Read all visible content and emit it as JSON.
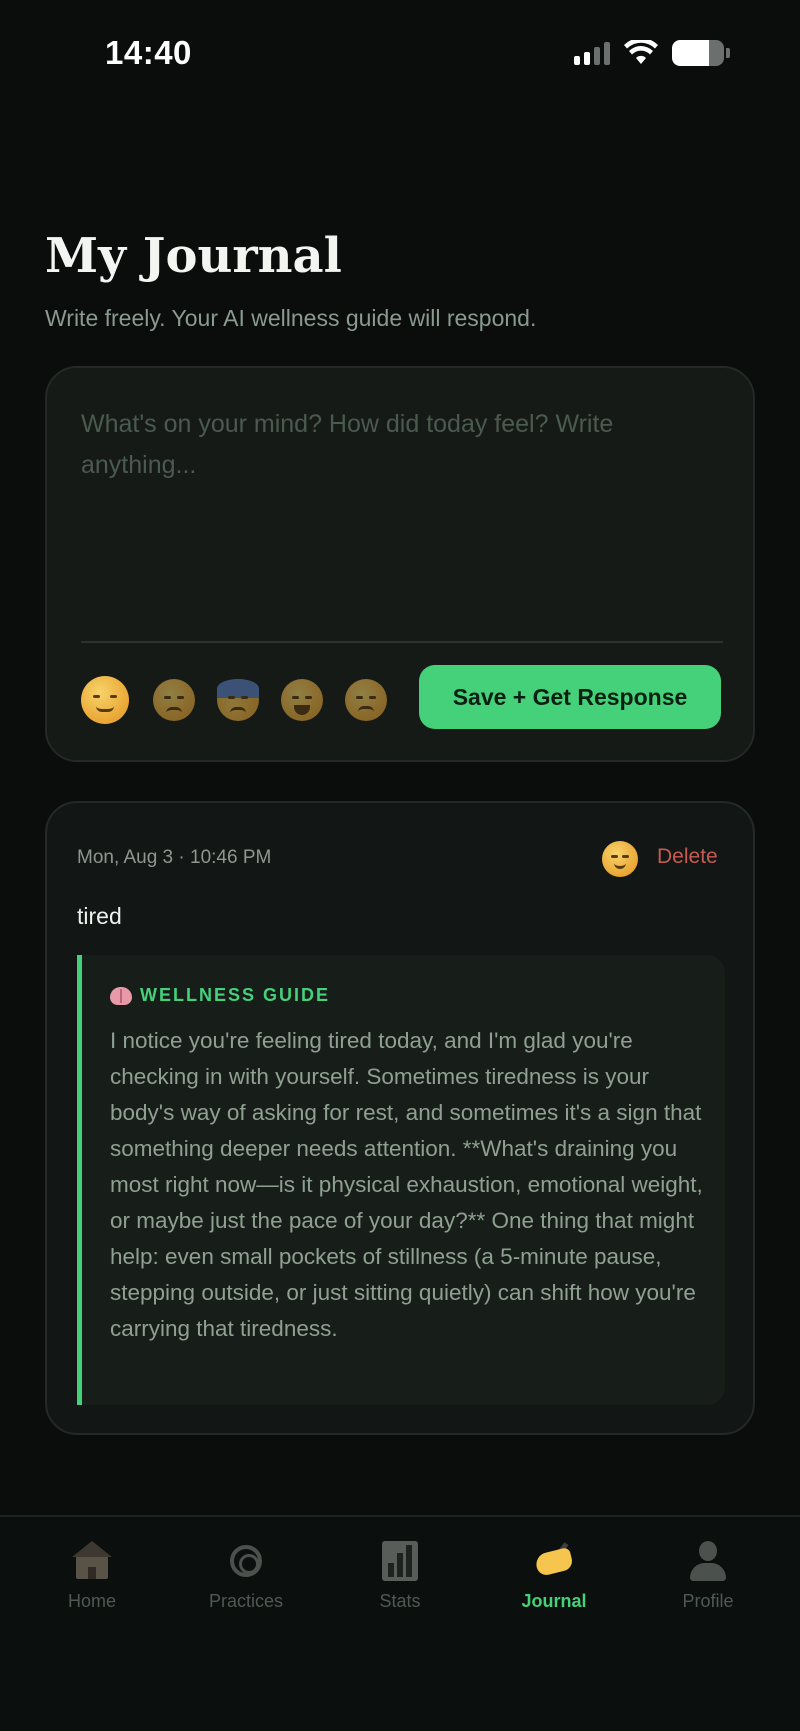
{
  "status_bar": {
    "time": "14:40"
  },
  "header": {
    "title": "My Journal",
    "subtitle": "Write freely. Your AI wellness guide will respond."
  },
  "compose": {
    "placeholder": "What's on your mind? How did today feel? Write anything...",
    "value": "",
    "moods": [
      {
        "icon": "relieved-face-icon",
        "selected": true
      },
      {
        "icon": "pensive-face-icon",
        "selected": false
      },
      {
        "icon": "anxious-face-icon",
        "selected": false
      },
      {
        "icon": "grinning-face-icon",
        "selected": false
      },
      {
        "icon": "angry-face-icon",
        "selected": false
      }
    ],
    "save_label": "Save + Get Response"
  },
  "entries": [
    {
      "date": "Mon, Aug 3 · 10:46 PM",
      "mood_icon": "relieved-face-icon",
      "delete_label": "Delete",
      "text": "tired",
      "guide": {
        "icon": "brain-icon",
        "label": "WELLNESS GUIDE",
        "response": "I notice you're feeling tired today, and I'm glad you're checking in with yourself. Sometimes tiredness is your body's way of asking for rest, and sometimes it's a sign that something deeper needs attention. **What's draining you most right now—is it physical exhaustion, emotional weight, or maybe just the pace of your day?** One thing that might help: even small pockets of stillness (a 5-minute pause, stepping outside, or just sitting quietly) can shift how you're carrying that tiredness."
      }
    }
  ],
  "nav": {
    "items": [
      {
        "label": "Home",
        "icon": "home-icon",
        "active": false
      },
      {
        "label": "Practices",
        "icon": "spiral-icon",
        "active": false
      },
      {
        "label": "Stats",
        "icon": "bar-chart-icon",
        "active": false
      },
      {
        "label": "Journal",
        "icon": "writing-hand-icon",
        "active": true
      },
      {
        "label": "Profile",
        "icon": "person-icon",
        "active": false
      }
    ]
  },
  "colors": {
    "background": "#0a0d0c",
    "accent": "#44d17a",
    "delete": "#c65a52",
    "card": "#151a17"
  }
}
